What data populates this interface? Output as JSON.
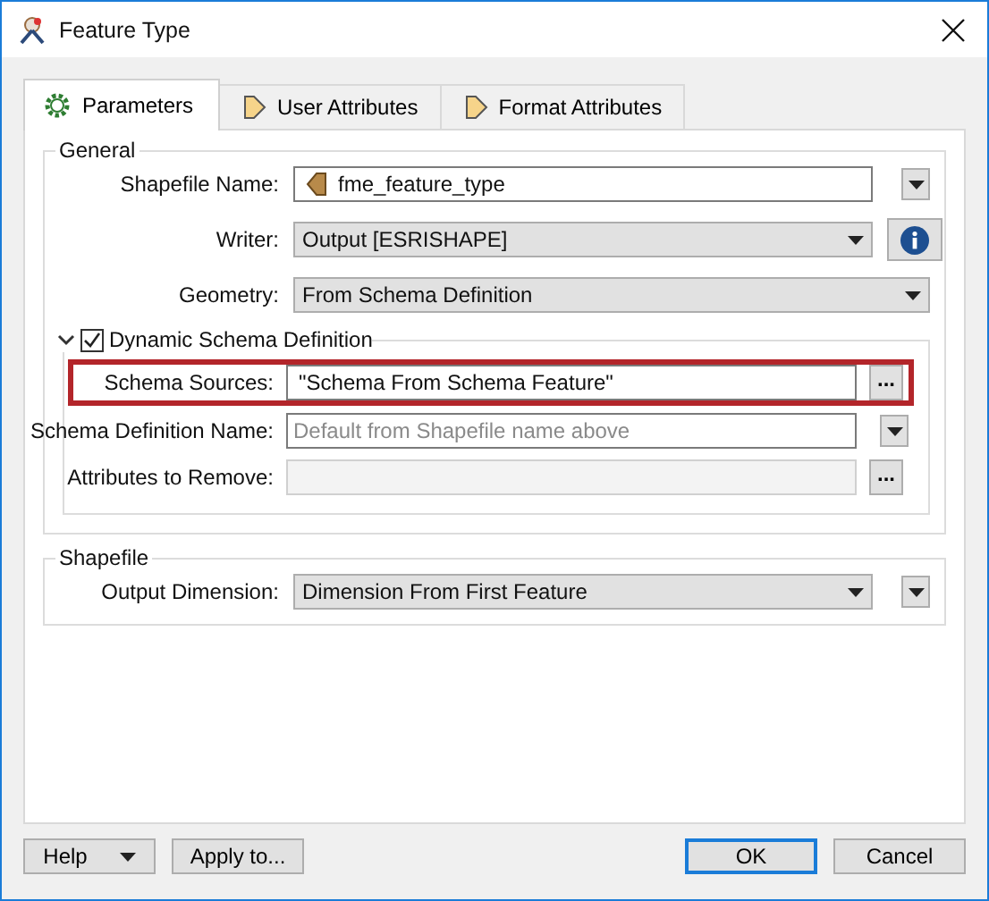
{
  "window": {
    "title": "Feature Type"
  },
  "tabs": [
    {
      "label": "Parameters",
      "selected": true
    },
    {
      "label": "User Attributes",
      "selected": false
    },
    {
      "label": "Format Attributes",
      "selected": false
    }
  ],
  "groups": [
    {
      "title": "General",
      "fields": [
        {
          "kind": "name",
          "label": "Shapefile Name:",
          "value": "fme_feature_type",
          "button": {
            "kind": "menu"
          }
        },
        {
          "kind": "combo",
          "label": "Writer:",
          "value": "Output [ESRISHAPE]",
          "button": {
            "kind": "info"
          }
        },
        {
          "kind": "combo",
          "label": "Geometry:",
          "value": "From Schema Definition"
        }
      ],
      "subgroup": {
        "title": "Dynamic Schema Definition",
        "checked": true,
        "expanded": true,
        "fields": [
          {
            "kind": "text",
            "label": "Schema Sources:",
            "value": "\"Schema From Schema Feature\"",
            "highlighted": true,
            "button": {
              "kind": "text",
              "label": "..."
            }
          },
          {
            "kind": "text",
            "label": "Schema Definition Name:",
            "placeholder": "Default from Shapefile name above",
            "highlighted": false,
            "button": {
              "kind": "menu"
            }
          },
          {
            "kind": "disabled",
            "label": "Attributes to Remove:",
            "highlighted": false,
            "button": {
              "kind": "text",
              "label": "..."
            }
          }
        ]
      }
    },
    {
      "title": "Shapefile",
      "fields": [
        {
          "kind": "combo",
          "label": "Output Dimension:",
          "value": "Dimension From First Feature",
          "button": {
            "kind": "menu"
          }
        }
      ]
    }
  ],
  "buttons": [
    {
      "label": "Help",
      "menu": true,
      "default": false
    },
    {
      "label": "Apply to...",
      "menu": false,
      "default": false
    },
    {
      "label": "OK",
      "menu": false,
      "default": true
    },
    {
      "label": "Cancel",
      "menu": false,
      "default": false
    }
  ]
}
